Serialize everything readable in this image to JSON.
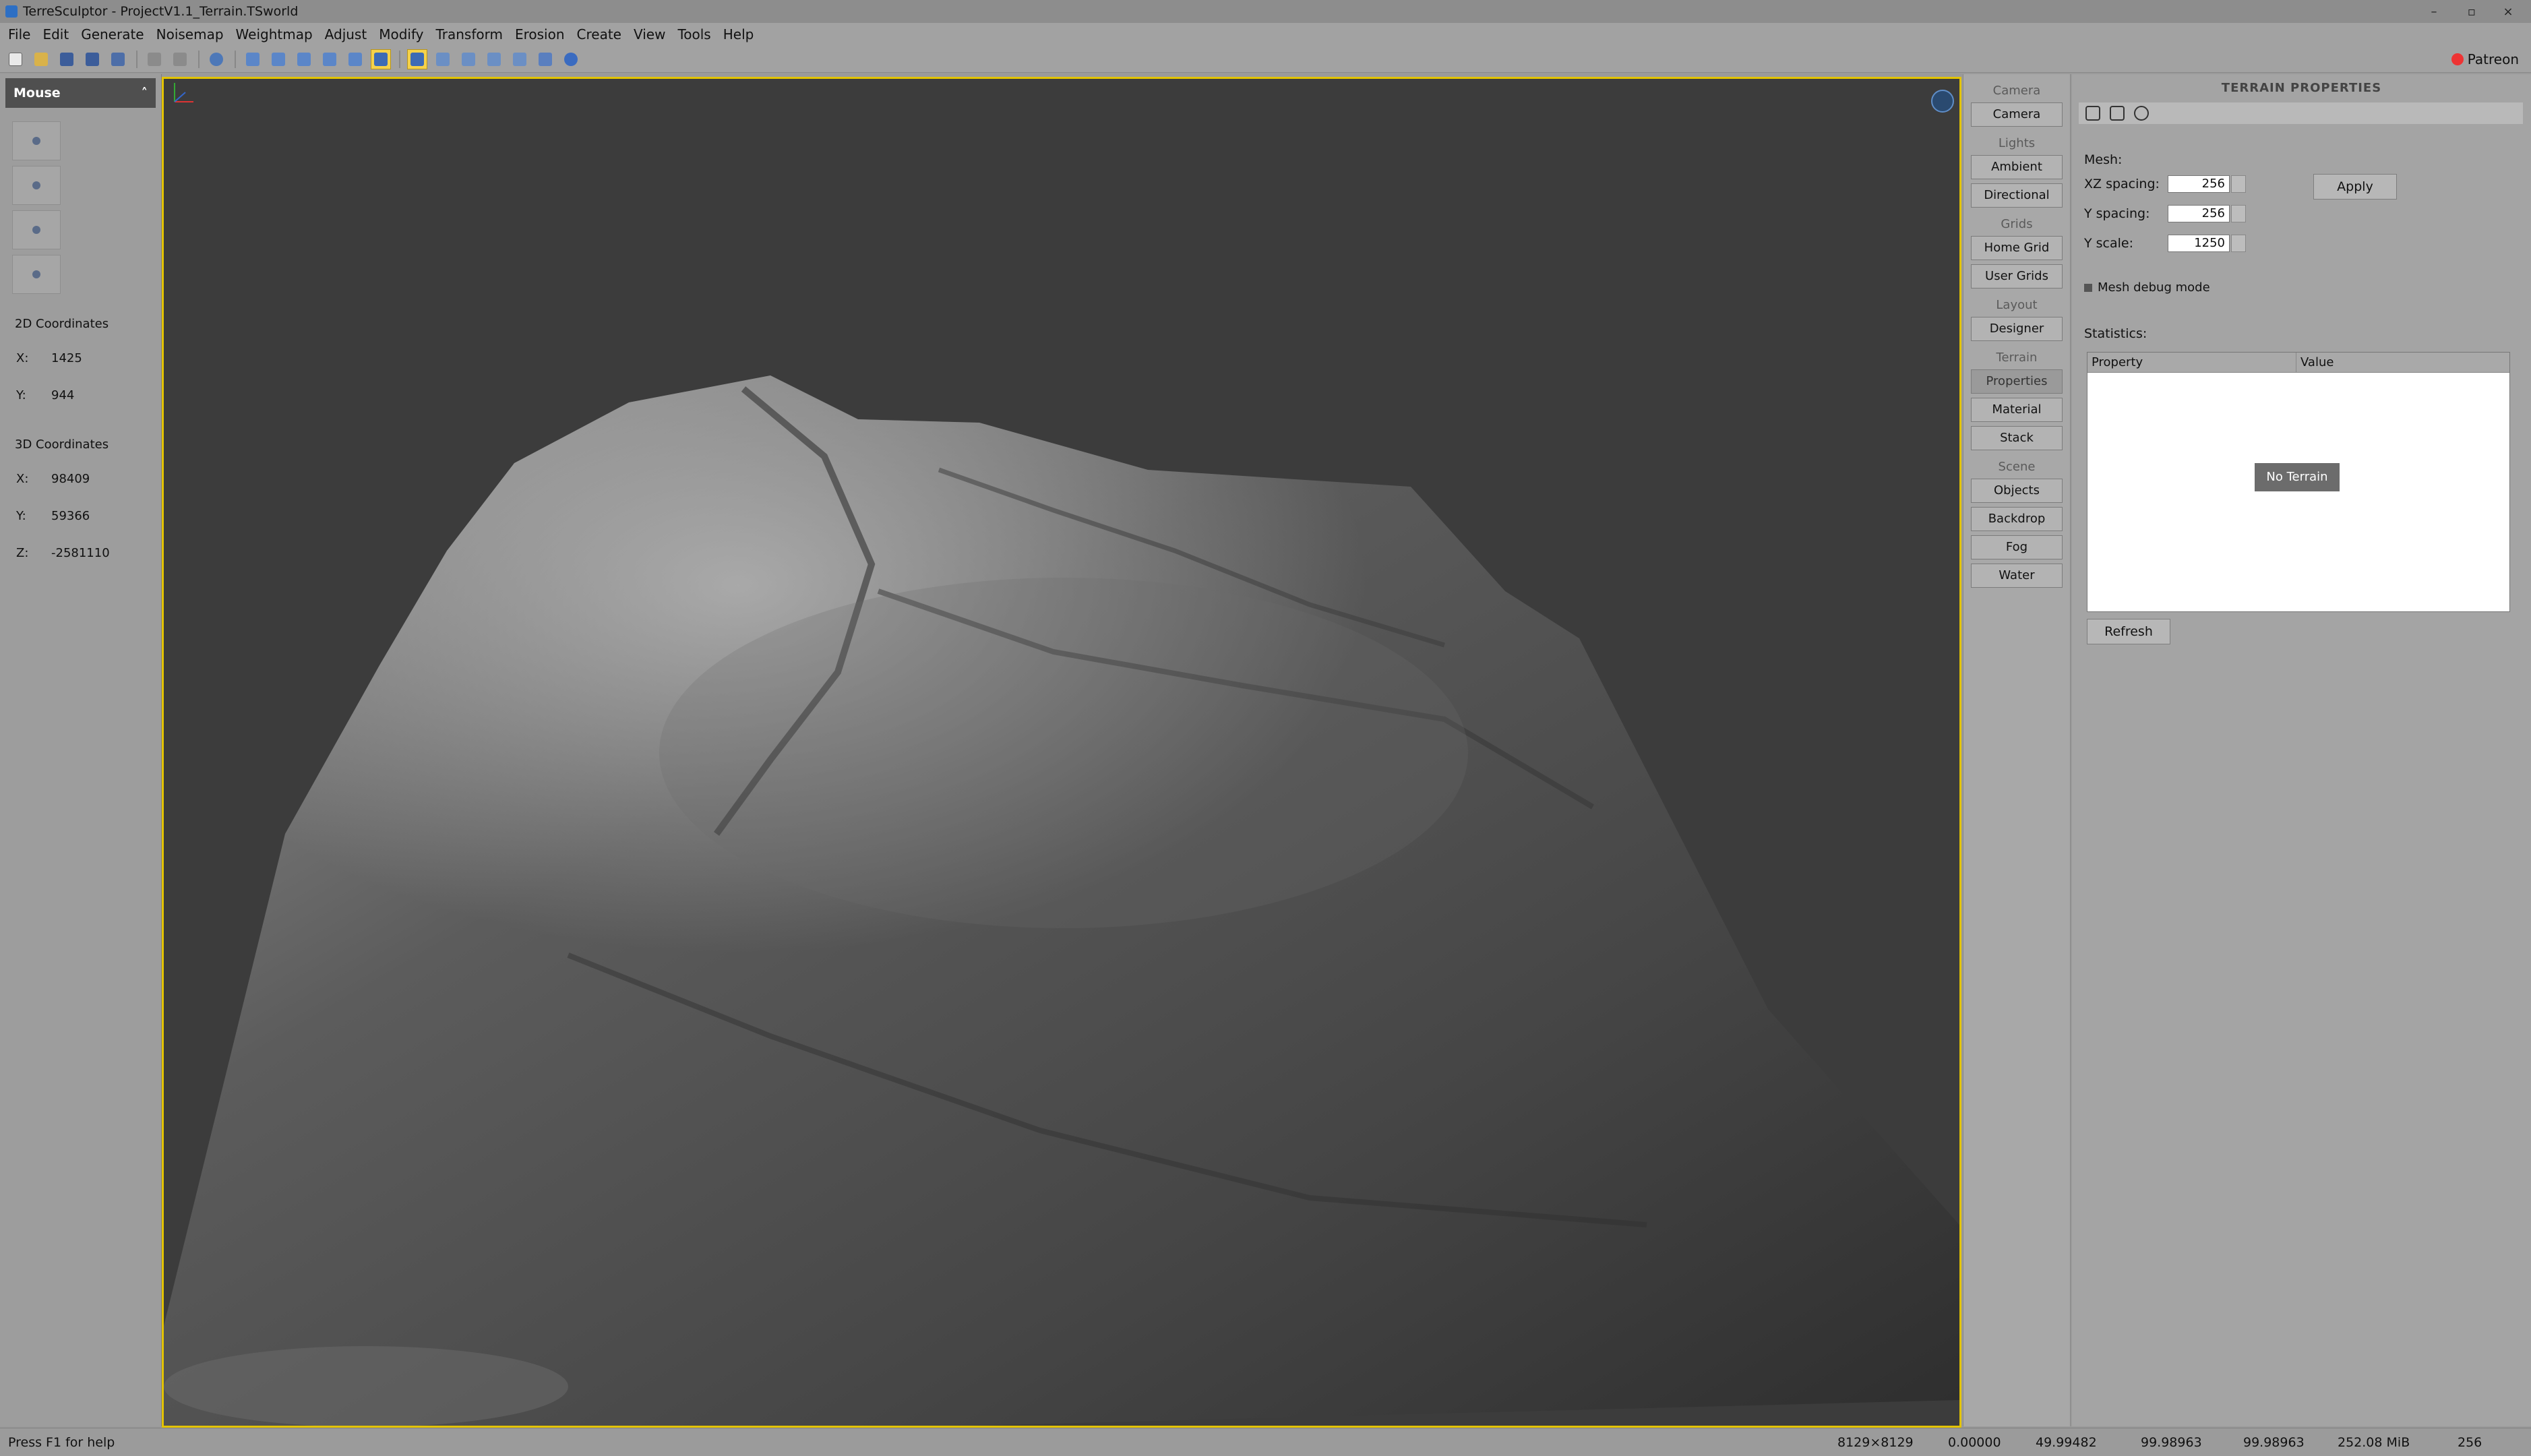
{
  "window": {
    "title": "TerreSculptor - ProjectV1.1_Terrain.TSworld",
    "controls": [
      "–",
      "▫",
      "×"
    ]
  },
  "menu": [
    "File",
    "Edit",
    "Generate",
    "Noisemap",
    "Weightmap",
    "Adjust",
    "Modify",
    "Transform",
    "Erosion",
    "Create",
    "View",
    "Tools",
    "Help"
  ],
  "toolbar": {
    "patreon_label": "Patreon",
    "icons": [
      "new-icon",
      "open-icon",
      "save-icon",
      "save-as-icon",
      "export-icon",
      "undo-icon",
      "redo-icon",
      "zoom-icon",
      "view-top-icon",
      "view-front-icon",
      "view-side-icon",
      "view-left-icon",
      "view-right-icon",
      "view-perspective-icon",
      "render-mode-icon",
      "wireframe-icon",
      "shaded-icon",
      "camera-icon",
      "layout-icon",
      "grid-icon",
      "sphere-icon"
    ]
  },
  "left_panel": {
    "header": "Mouse",
    "header_arrow": "˄",
    "coords2d_title": "2D Coordinates",
    "coords2d": {
      "x_label": "X:",
      "x": "1425",
      "y_label": "Y:",
      "y": "944"
    },
    "coords3d_title": "3D Coordinates",
    "coords3d": {
      "x_label": "X:",
      "x": "98409",
      "y_label": "Y:",
      "y": "59366",
      "z_label": "Z:",
      "z": "-2581110"
    }
  },
  "scene_panel": {
    "groups": [
      {
        "label": "Camera",
        "buttons": [
          "Camera"
        ]
      },
      {
        "label": "Lights",
        "buttons": [
          "Ambient",
          "Directional"
        ]
      },
      {
        "label": "Grids",
        "buttons": [
          "Home Grid",
          "User Grids"
        ]
      },
      {
        "label": "Layout",
        "buttons": [
          "Designer"
        ]
      },
      {
        "label": "Terrain",
        "buttons": [
          "Properties",
          "Material",
          "Stack"
        ]
      },
      {
        "label": "Scene",
        "buttons": [
          "Objects",
          "Backdrop",
          "Fog",
          "Water"
        ]
      }
    ],
    "active_button": "Properties"
  },
  "props": {
    "title": "TERRAIN PROPERTIES",
    "mesh_label": "Mesh:",
    "xz_label": "XZ spacing:",
    "xz_value": "256",
    "y_spacing_label": "Y spacing:",
    "y_spacing_value": "256",
    "y_scale_label": "Y scale:",
    "y_scale_value": "1250",
    "apply": "Apply",
    "debug_label": "Mesh debug mode",
    "stats_label": "Statistics:",
    "col_property": "Property",
    "col_value": "Value",
    "no_terrain": "No Terrain",
    "refresh": "Refresh"
  },
  "status": {
    "help": "Press F1 for help",
    "cells": [
      "8129×8129",
      "0.00000",
      "49.99482",
      "99.98963",
      "99.98963",
      "252.08 MiB",
      "256"
    ]
  },
  "colors": {
    "viewport_border": "#e3c300",
    "viewport_bg": "#3c3c3c",
    "active_tool": "#f5d24a"
  }
}
